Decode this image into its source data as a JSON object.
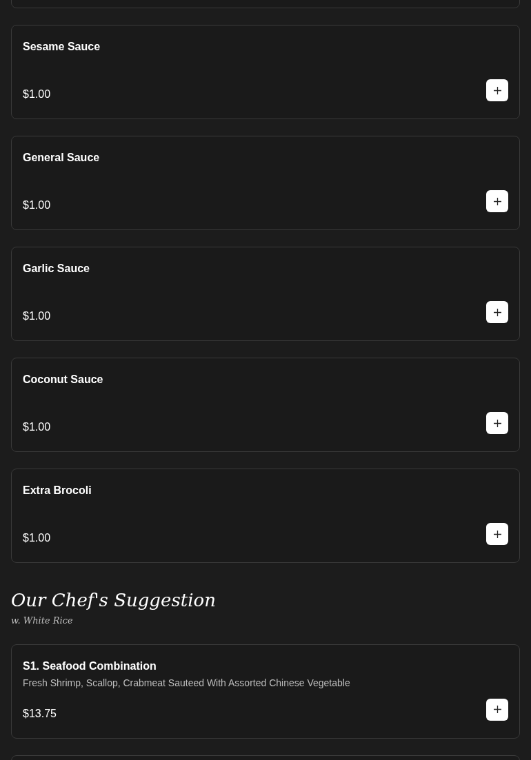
{
  "items": [
    {
      "name": "Sesame Sauce",
      "price": "$1.00"
    },
    {
      "name": "General Sauce",
      "price": "$1.00"
    },
    {
      "name": "Garlic Sauce",
      "price": "$1.00"
    },
    {
      "name": "Coconut Sauce",
      "price": "$1.00"
    },
    {
      "name": "Extra Brocoli",
      "price": "$1.00"
    }
  ],
  "section": {
    "title": "Our Chef's Suggestion",
    "subtitle": "w. White Rice",
    "items": [
      {
        "name": "S1. Seafood Combination",
        "description": "Fresh Shrimp, Scallop, Crabmeat Sauteed With Assorted Chinese Vegetable",
        "price": "$13.75"
      }
    ]
  }
}
